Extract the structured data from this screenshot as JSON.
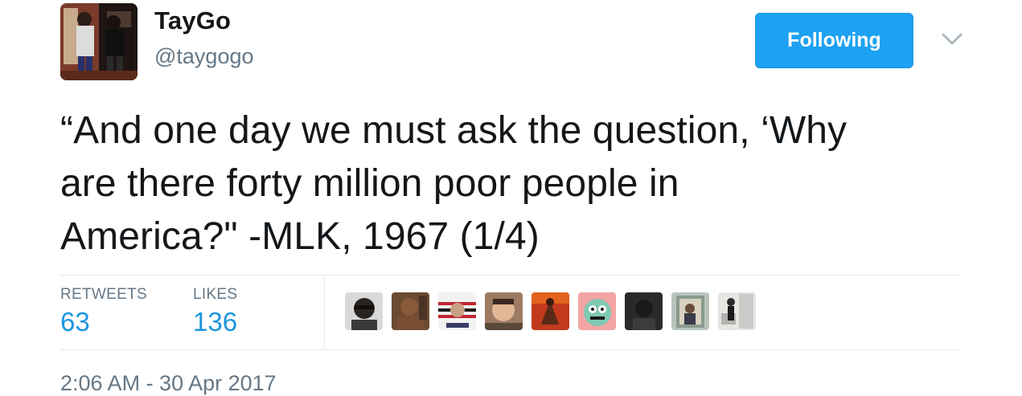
{
  "author": {
    "display_name": "TayGo",
    "handle": "@taygogo"
  },
  "follow_button": {
    "label": "Following",
    "color": "#1da1f2"
  },
  "menu": {
    "icon": "chevron-down-icon"
  },
  "tweet": {
    "text": "“And one day we must ask the question, ‘Why\nare there forty million poor people in\nAmerica?\" -MLK, 1967 (1/4)"
  },
  "stats": {
    "retweets_label": "RETWEETS",
    "retweets_count": "63",
    "likes_label": "LIKES",
    "likes_count": "136"
  },
  "liked_by_avatars": [
    {
      "name": "liker-avatar-1"
    },
    {
      "name": "liker-avatar-2"
    },
    {
      "name": "liker-avatar-3"
    },
    {
      "name": "liker-avatar-4"
    },
    {
      "name": "liker-avatar-5"
    },
    {
      "name": "liker-avatar-6"
    },
    {
      "name": "liker-avatar-7"
    },
    {
      "name": "liker-avatar-8"
    },
    {
      "name": "liker-avatar-9"
    }
  ],
  "timestamp": "2:06 AM - 30 Apr 2017",
  "colors": {
    "link": "#1b95e0",
    "muted": "#657786",
    "text": "#14171a",
    "divider": "#e1e8ed"
  }
}
